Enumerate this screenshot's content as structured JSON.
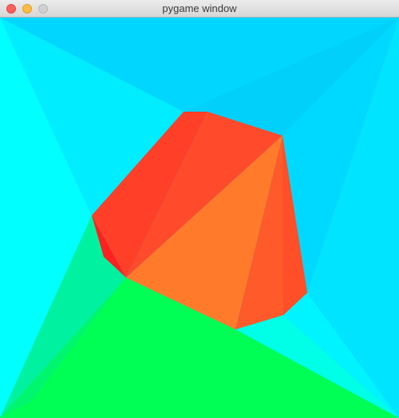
{
  "window": {
    "title": "pygame window"
  },
  "scene": {
    "background_color": "#00d8ff",
    "floor_color": "#00ff55",
    "shape_colors": {
      "top_face": "#ff4b2b",
      "front_face": "#ff7a2a",
      "side_face": "#ff5a2a",
      "dark_edge": "#ff2b1f"
    },
    "triangles": [
      {
        "name": "bg-top",
        "color": "#00d6ff"
      },
      {
        "name": "bg-left",
        "color": "#00ffff"
      },
      {
        "name": "bg-right",
        "color": "#00e8ff"
      },
      {
        "name": "floor-left",
        "color": "#00f096"
      },
      {
        "name": "floor-main",
        "color": "#00ff55"
      },
      {
        "name": "floor-right-sliver",
        "color": "#00ffe6"
      },
      {
        "name": "shape-top-left",
        "color": "#ff3f28"
      },
      {
        "name": "shape-top-right",
        "color": "#ff4a2b"
      },
      {
        "name": "shape-front",
        "color": "#ff7b2b"
      },
      {
        "name": "shape-right",
        "color": "#ff5a2a"
      },
      {
        "name": "shape-left-edge",
        "color": "#ff2020"
      }
    ]
  }
}
